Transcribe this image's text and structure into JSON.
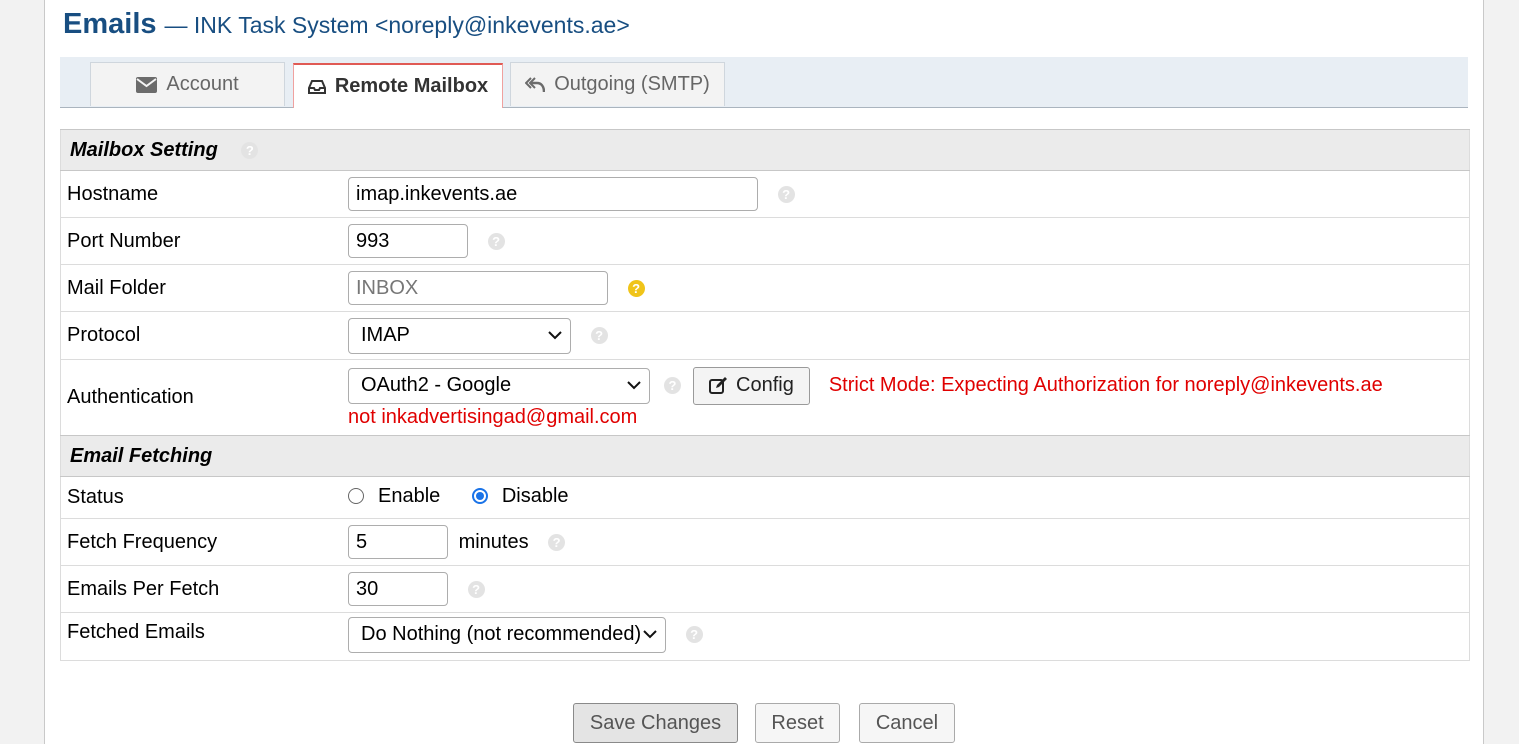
{
  "header": {
    "title": "Emails",
    "subtitle": "— INK Task System <noreply@inkevents.ae>"
  },
  "tabs": [
    {
      "label": "Account",
      "icon": "envelope-icon"
    },
    {
      "label": "Remote Mailbox",
      "icon": "inbox-icon",
      "active": true
    },
    {
      "label": "Outgoing (SMTP)",
      "icon": "reply-all-icon"
    }
  ],
  "mailbox": {
    "section_title": "Mailbox Setting",
    "hostname": {
      "label": "Hostname",
      "value": "imap.inkevents.ae"
    },
    "port": {
      "label": "Port Number",
      "value": "993"
    },
    "folder": {
      "label": "Mail Folder",
      "placeholder": "INBOX"
    },
    "protocol": {
      "label": "Protocol",
      "value": "IMAP"
    },
    "auth": {
      "label": "Authentication",
      "value": "OAuth2 - Google",
      "config_label": "Config",
      "warning_line1": "Strict Mode: Expecting Authorization for noreply@inkevents.ae",
      "warning_line2": "not inkadvertisingad@gmail.com"
    }
  },
  "fetching": {
    "section_title": "Email Fetching",
    "status": {
      "label": "Status",
      "enable": "Enable",
      "disable": "Disable",
      "selected": "Disable"
    },
    "frequency": {
      "label": "Fetch Frequency",
      "value": "5",
      "unit": "minutes"
    },
    "per_fetch": {
      "label": "Emails Per Fetch",
      "value": "30"
    },
    "fetched": {
      "label": "Fetched Emails",
      "value": "Do Nothing (not recommended)"
    }
  },
  "actions": {
    "save": "Save Changes",
    "reset": "Reset",
    "cancel": "Cancel"
  },
  "colors": {
    "title": "#184e81",
    "warning": "#e00000",
    "active_tab_border": "#e05a54"
  }
}
